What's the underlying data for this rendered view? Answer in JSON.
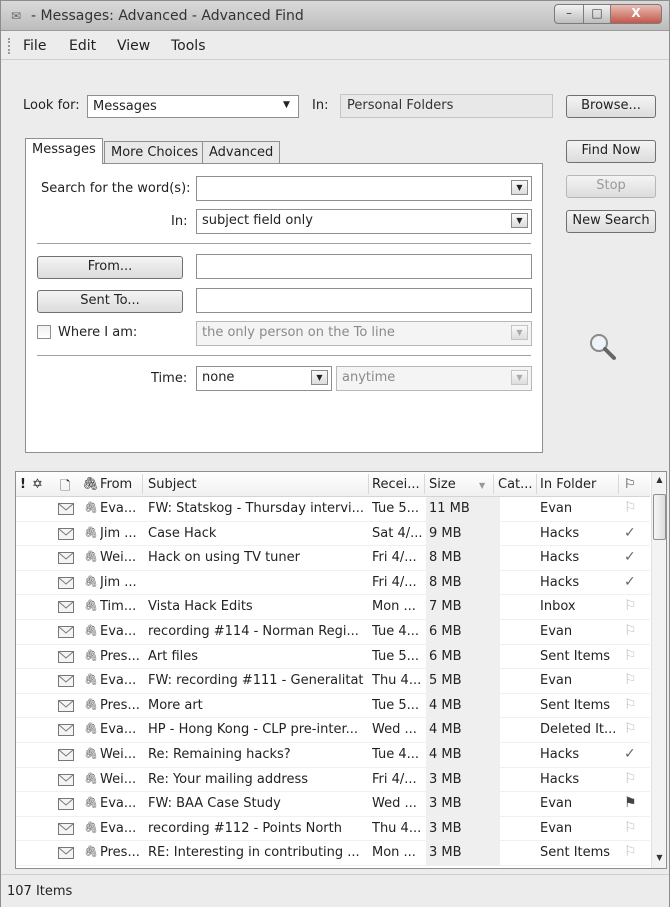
{
  "window": {
    "title": "- Messages: Advanced - Advanced Find",
    "minimize_label": "–",
    "maximize_label": "□",
    "close_label": "X"
  },
  "menu": [
    "File",
    "Edit",
    "View",
    "Tools"
  ],
  "look_for": {
    "label": "Look for:",
    "value": "Messages",
    "in_label": "In:",
    "in_value": "Personal Folders",
    "browse_label": "Browse..."
  },
  "actions": {
    "find_now": "Find Now",
    "stop": "Stop",
    "new_search": "New Search"
  },
  "tabs": [
    "Messages",
    "More Choices",
    "Advanced"
  ],
  "messages_tab": {
    "search_words_label": "Search for the word(s):",
    "search_words_value": "",
    "in_label": "In:",
    "in_value": "subject field only",
    "from_button": "From...",
    "from_value": "",
    "sent_to_button": "Sent To...",
    "sent_to_value": "",
    "where_label": "Where I am:",
    "where_value": "the only person on the To line",
    "time_label": "Time:",
    "time_value": "none",
    "time_range_value": "anytime"
  },
  "columns": {
    "importance": "!",
    "reminder": "✡",
    "icon": "🗋",
    "attachment": "🖇",
    "from": "From",
    "subject": "Subject",
    "received": "Recei...",
    "size": "Size",
    "categories": "Cat...",
    "folder": "In Folder",
    "flag": "⚐"
  },
  "rows": [
    {
      "from": "Eva...",
      "subject": "FW: Statskog - Thursday intervi...",
      "received": "Tue 5...",
      "size": "11 MB",
      "folder": "Evan",
      "flag": "none"
    },
    {
      "from": "Jim ...",
      "subject": "Case Hack",
      "received": "Sat 4/...",
      "size": "9 MB",
      "folder": "Hacks",
      "flag": "done"
    },
    {
      "from": "Wei...",
      "subject": "Hack on using TV tuner",
      "received": "Fri 4/...",
      "size": "8 MB",
      "folder": "Hacks",
      "flag": "done"
    },
    {
      "from": "Jim ...",
      "subject": "",
      "received": "Fri 4/...",
      "size": "8 MB",
      "folder": "Hacks",
      "flag": "done"
    },
    {
      "from": "Tim...",
      "subject": "Vista Hack Edits",
      "received": "Mon ...",
      "size": "7 MB",
      "folder": "Inbox",
      "flag": "none"
    },
    {
      "from": "Eva...",
      "subject": "recording #114 - Norman Regi...",
      "received": "Tue 4...",
      "size": "6 MB",
      "folder": "Evan",
      "flag": "none"
    },
    {
      "from": "Pres...",
      "subject": "Art files",
      "received": "Tue 5...",
      "size": "6 MB",
      "folder": "Sent Items",
      "flag": "none"
    },
    {
      "from": "Eva...",
      "subject": "FW: recording #111 - Generalitat",
      "received": "Thu 4...",
      "size": "5 MB",
      "folder": "Evan",
      "flag": "none"
    },
    {
      "from": "Pres...",
      "subject": "More art",
      "received": "Tue 5...",
      "size": "4 MB",
      "folder": "Sent Items",
      "flag": "none"
    },
    {
      "from": "Eva...",
      "subject": "HP - Hong Kong - CLP pre-inter...",
      "received": "Wed ...",
      "size": "4 MB",
      "folder": "Deleted It...",
      "flag": "none"
    },
    {
      "from": "Wei...",
      "subject": "Re: Remaining hacks?",
      "received": "Tue 4...",
      "size": "4 MB",
      "folder": "Hacks",
      "flag": "done"
    },
    {
      "from": "Wei...",
      "subject": "Re: Your mailing address",
      "received": "Fri 4/...",
      "size": "3 MB",
      "folder": "Hacks",
      "flag": "none"
    },
    {
      "from": "Eva...",
      "subject": "FW: BAA Case Study",
      "received": "Wed ...",
      "size": "3 MB",
      "folder": "Evan",
      "flag": "red"
    },
    {
      "from": "Eva...",
      "subject": "recording #112 - Points North",
      "received": "Thu 4...",
      "size": "3 MB",
      "folder": "Evan",
      "flag": "none"
    },
    {
      "from": "Pres...",
      "subject": "RE: Interesting in contributing ...",
      "received": "Mon ...",
      "size": "3 MB",
      "folder": "Sent Items",
      "flag": "none"
    }
  ],
  "status": {
    "items": "107 Items"
  }
}
